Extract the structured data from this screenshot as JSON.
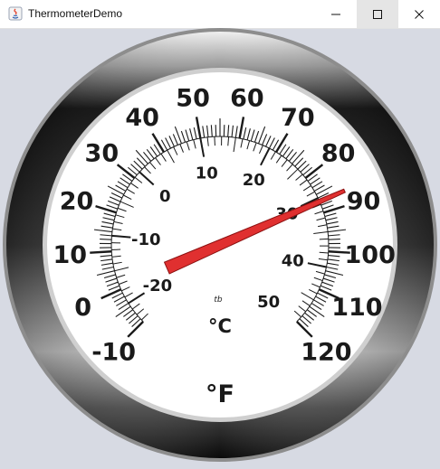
{
  "window": {
    "title": "ThermometerDemo",
    "controls": {
      "minimize": "minimize",
      "maximize": "maximize",
      "close": "close"
    }
  },
  "thermometer": {
    "fahrenheit_scale": {
      "labels": [
        "-10",
        "0",
        "10",
        "20",
        "30",
        "40",
        "50",
        "60",
        "70",
        "80",
        "90",
        "100",
        "110",
        "120"
      ],
      "unit": "°F"
    },
    "celsius_scale": {
      "labels": [
        "-20",
        "-10",
        "0",
        "10",
        "20",
        "30",
        "40",
        "50"
      ],
      "unit": "°C"
    },
    "maker_mark": "tb",
    "reading_fahrenheit": 87,
    "colors": {
      "needle": "#e03030",
      "dial": "#ffffff",
      "text": "#1a1a1a",
      "background": "#d7dae3"
    }
  }
}
